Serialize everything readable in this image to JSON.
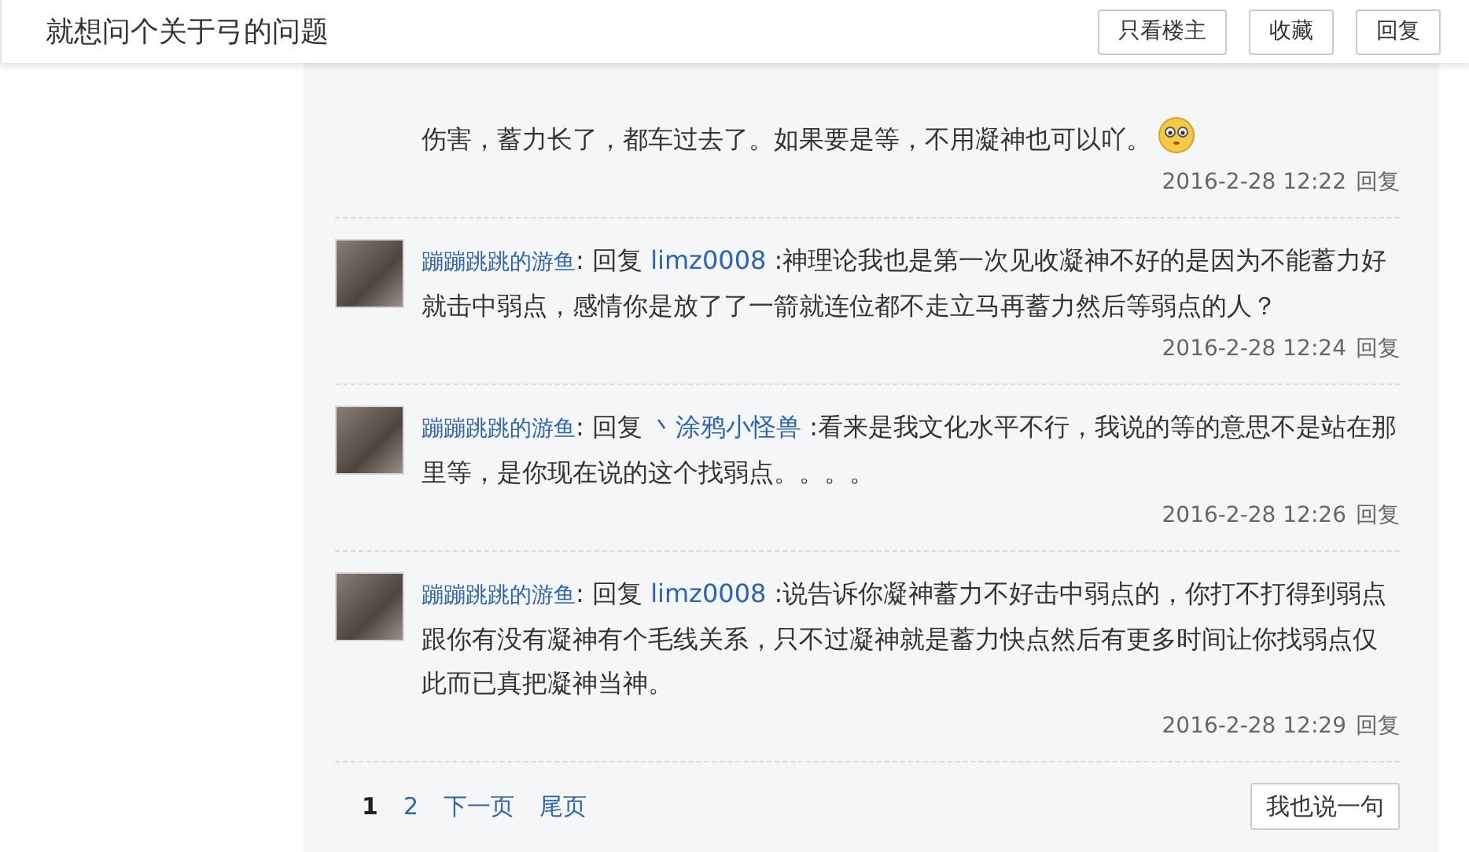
{
  "header": {
    "title": "就想问个关于弓的问题",
    "buttons": [
      "只看楼主",
      "收藏",
      "回复"
    ]
  },
  "comments": [
    {
      "kind": "continued",
      "text": "伤害，蓄力长了，都车过去了。如果要是等，不用凝神也可以吖。",
      "emoji": true,
      "time": "2016-2-28 12:22",
      "reply": "回复"
    },
    {
      "kind": "reply",
      "author": "蹦蹦跳跳的游鱼",
      "reply_word": ": 回复",
      "target": "limz0008",
      "text": " :神理论我也是第一次见收凝神不好的是因为不能蓄力好就击中弱点，感情你是放了了一箭就连位都不走立马再蓄力然后等弱点的人？",
      "time": "2016-2-28 12:24",
      "reply": "回复"
    },
    {
      "kind": "reply",
      "author": "蹦蹦跳跳的游鱼",
      "reply_word": ": 回复",
      "target": "丶涂鸦小怪兽",
      "text": " :看来是我文化水平不行，我说的等的意思不是站在那里等，是你现在说的这个找弱点。。。。",
      "time": "2016-2-28 12:26",
      "reply": "回复"
    },
    {
      "kind": "reply",
      "author": "蹦蹦跳跳的游鱼",
      "reply_word": ": 回复",
      "target": "limz0008",
      "text": " :说告诉你凝神蓄力不好击中弱点的，你打不打得到弱点跟你有没有凝神有个毛线关系，只不过凝神就是蓄力快点然后有更多时间让你找弱点仅此而已真把凝神当神。",
      "time": "2016-2-28 12:29",
      "reply": "回复"
    }
  ],
  "pagination": {
    "pages": [
      {
        "label": "1",
        "selected": true
      },
      {
        "label": "2",
        "selected": false
      }
    ],
    "links": [
      "下一页",
      "尾页"
    ],
    "post_button": "我也说一句"
  }
}
